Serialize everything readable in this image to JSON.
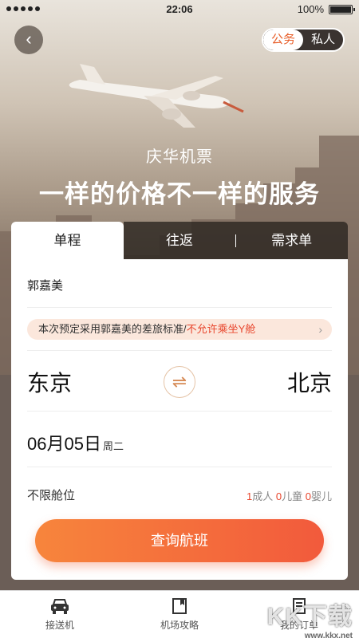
{
  "status_bar": {
    "time": "22:06",
    "battery": "100%"
  },
  "header": {
    "toggle_options": [
      "公务",
      "私人"
    ],
    "brand": "庆华机票",
    "slogan": "一样的价格不一样的服务"
  },
  "trip_tabs": [
    "单程",
    "往返",
    "需求单"
  ],
  "form": {
    "passenger": "郭嘉美",
    "notice_prefix": "本次预定采用郭嘉美的差旅标准/",
    "notice_highlight": "不允许乘坐Y舱",
    "from_city": "东京",
    "to_city": "北京",
    "date": "06月05日",
    "weekday": "周二",
    "cabin": "不限舱位",
    "adults_count": "1",
    "adults_label": "成人",
    "children_count": "0",
    "children_label": "儿童",
    "infants_count": "0",
    "infants_label": "婴儿",
    "search_label": "查询航班"
  },
  "bottom_nav": [
    {
      "label": "接送机",
      "icon": "car-icon"
    },
    {
      "label": "机场攻略",
      "icon": "book-icon"
    },
    {
      "label": "我的订单",
      "icon": "order-icon"
    }
  ],
  "watermark": {
    "text": "KK下载",
    "url": "www.kkx.net"
  },
  "colors": {
    "accent": "#f25a3c",
    "accent_light": "#f7853c",
    "highlight": "#e8452c"
  }
}
